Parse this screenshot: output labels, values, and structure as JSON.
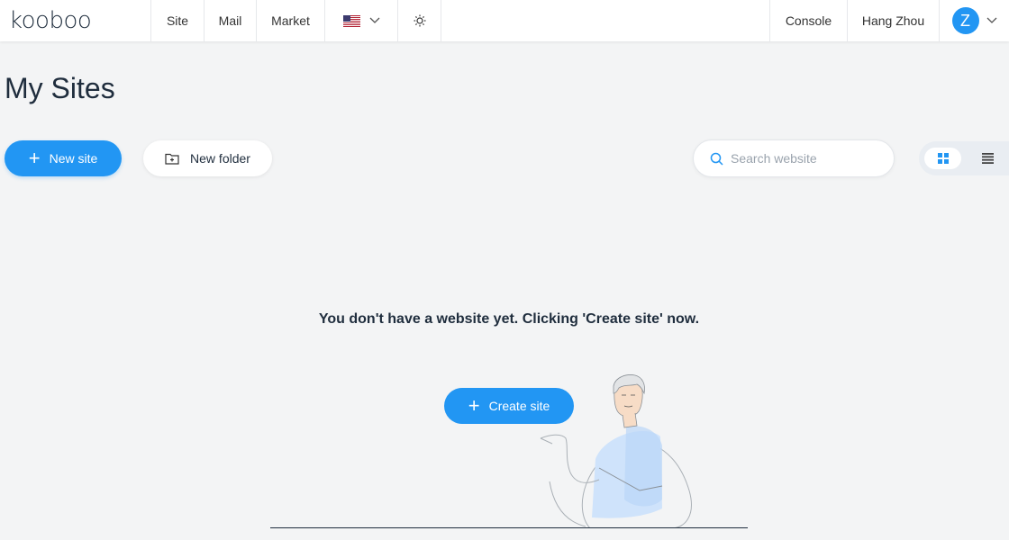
{
  "app": {
    "logo_text": "kooboo"
  },
  "nav": {
    "site": "Site",
    "mail": "Mail",
    "market": "Market",
    "language_icon": "us-flag-icon",
    "theme_icon": "sun-icon",
    "console": "Console",
    "user_name": "Hang Zhou",
    "avatar_letter": "Z"
  },
  "page": {
    "title": "My Sites"
  },
  "toolbar": {
    "new_site": "New site",
    "new_folder": "New folder",
    "search_placeholder": "Search website",
    "search_value": ""
  },
  "empty_state": {
    "message": "You don't have a website yet. Clicking 'Create site' now.",
    "create_button": "Create site"
  },
  "colors": {
    "accent": "#2296f3",
    "background": "#f3f4f5",
    "text": "#1f2d3d"
  }
}
